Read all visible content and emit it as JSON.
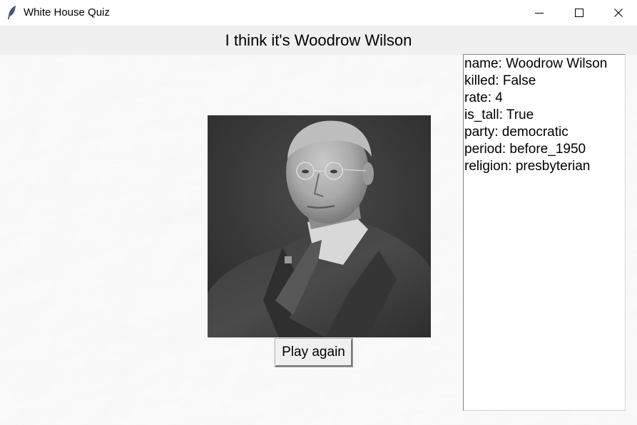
{
  "window": {
    "title": "White House Quiz",
    "icon": "feather-icon",
    "controls": [
      "minimize-icon",
      "maximize-icon",
      "close-icon"
    ]
  },
  "heading": {
    "text": "I think it's Woodrow Wilson"
  },
  "portrait": {
    "subject": "Woodrow Wilson"
  },
  "play_again_button": {
    "label": "Play again"
  },
  "info": {
    "lines": [
      "name: Woodrow Wilson",
      "killed: False",
      "rate: 4",
      "is_tall: True",
      "party: democratic",
      "period: before_1950",
      "religion: presbyterian"
    ]
  },
  "colors": {
    "titlebar": "#ffffff",
    "window_bg": "#f0f0f0",
    "panel_bg": "#ffffff",
    "text": "#000000"
  }
}
